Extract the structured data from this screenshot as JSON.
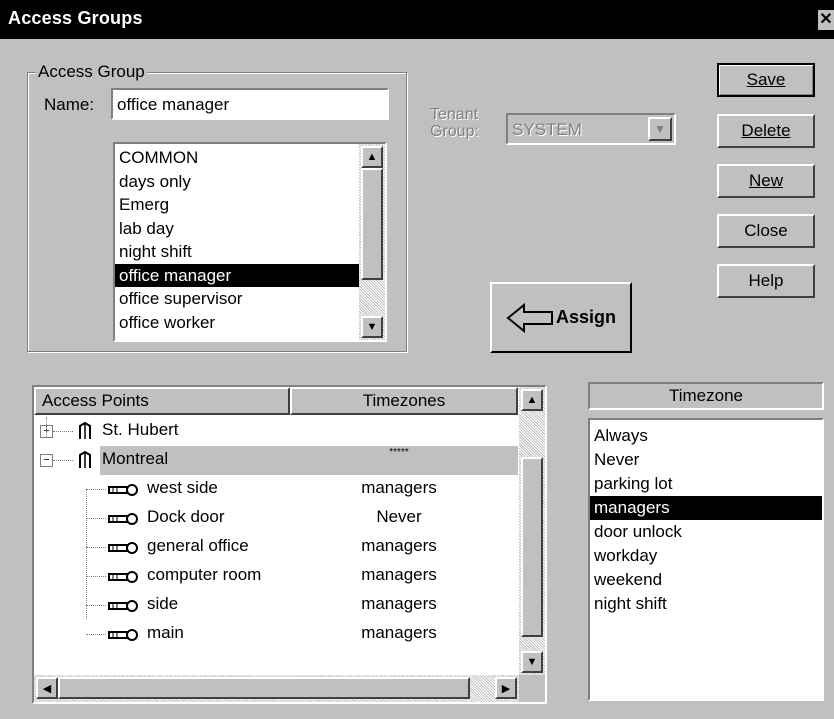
{
  "window": {
    "title": "Access Groups",
    "close_glyph": "✕"
  },
  "access_group": {
    "legend": "Access Group",
    "name_label": "Name:",
    "name_value": "office manager",
    "items": [
      {
        "label": "COMMON",
        "selected": false
      },
      {
        "label": "days only",
        "selected": false
      },
      {
        "label": "Emerg",
        "selected": false
      },
      {
        "label": "lab day",
        "selected": false
      },
      {
        "label": "night shift",
        "selected": false
      },
      {
        "label": "office manager",
        "selected": true
      },
      {
        "label": "office supervisor",
        "selected": false
      },
      {
        "label": "office worker",
        "selected": false
      }
    ]
  },
  "tenant": {
    "label_line1": "Tenant",
    "label_line2": "Group:",
    "value": "SYSTEM"
  },
  "buttons": {
    "save": "Save",
    "delete": "Delete",
    "new": "New",
    "close": "Close",
    "help": "Help",
    "assign": "Assign"
  },
  "access_points": {
    "header_points": "Access Points",
    "header_timezones": "Timezones",
    "rows": [
      {
        "type": "site",
        "expander": "+",
        "label": "St. Hubert",
        "tz": "",
        "highlight": false
      },
      {
        "type": "site",
        "expander": "−",
        "label": "Montreal",
        "tz": "*****",
        "highlight": true
      },
      {
        "type": "door",
        "label": "west side",
        "tz": "managers"
      },
      {
        "type": "door",
        "label": "Dock door",
        "tz": "Never"
      },
      {
        "type": "door",
        "label": "general office",
        "tz": "managers"
      },
      {
        "type": "door",
        "label": "computer room",
        "tz": "managers"
      },
      {
        "type": "door",
        "label": "side",
        "tz": "managers"
      },
      {
        "type": "door",
        "label": "main",
        "tz": "managers"
      }
    ]
  },
  "timezone_list": {
    "header": "Timezone",
    "items": [
      {
        "label": "Always",
        "selected": false
      },
      {
        "label": "Never",
        "selected": false
      },
      {
        "label": "parking lot",
        "selected": false
      },
      {
        "label": "managers",
        "selected": true
      },
      {
        "label": "door unlock",
        "selected": false
      },
      {
        "label": "workday",
        "selected": false
      },
      {
        "label": "weekend",
        "selected": false
      },
      {
        "label": "night shift",
        "selected": false
      }
    ]
  }
}
